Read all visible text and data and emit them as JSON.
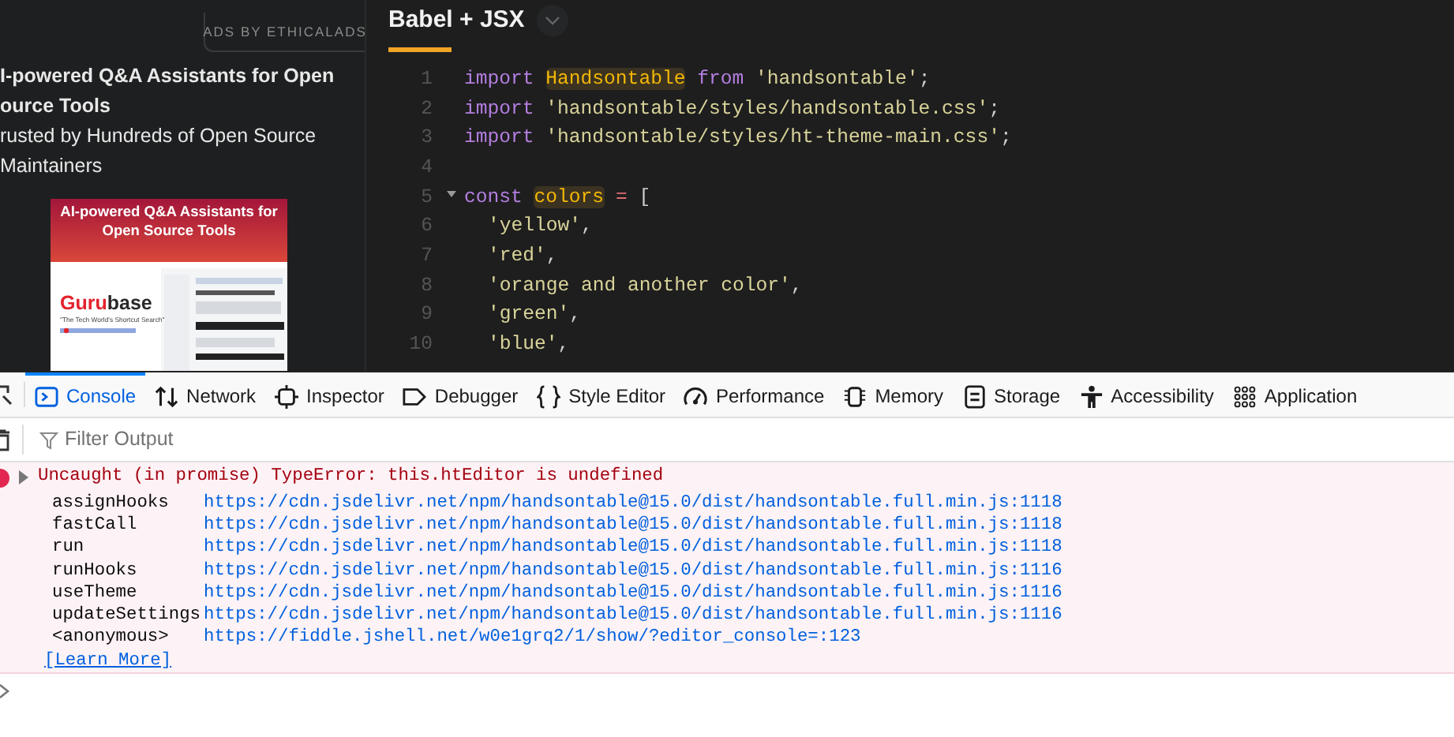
{
  "ad": {
    "label": "ADS BY ETHICALADS",
    "headline": "I-powered Q&A Assistants for Open\nource Tools",
    "body": "rusted by Hundreds of Open Source\nMaintainers",
    "banner": {
      "title": "AI-powered Q&A Assistants for Open Source Tools",
      "logo": [
        {
          "text": "Guru",
          "color": "#e3222c"
        },
        {
          "text": "base",
          "color": "#2a2a2a"
        }
      ],
      "tagline": "\"The Tech World's Shortcut Search\"",
      "kind": "picture"
    }
  },
  "editor": {
    "title": "Babel + JSX",
    "lines": [
      {
        "number": "1",
        "tokens": [
          {
            "kind": "keyword",
            "text": "import "
          },
          {
            "kind": "match",
            "text": "Handsontable"
          },
          {
            "kind": "keyword",
            "text": " from "
          },
          {
            "kind": "string",
            "text": "'handsontable'"
          },
          {
            "kind": "punct",
            "text": ";"
          }
        ]
      },
      {
        "number": "2",
        "tokens": [
          {
            "kind": "keyword",
            "text": "import "
          },
          {
            "kind": "string",
            "text": "'handsontable/styles/handsontable.css'"
          },
          {
            "kind": "punct",
            "text": ";"
          }
        ]
      },
      {
        "number": "3",
        "tokens": [
          {
            "kind": "keyword",
            "text": "import "
          },
          {
            "kind": "string",
            "text": "'handsontable/styles/ht-theme-main.css'"
          },
          {
            "kind": "punct",
            "text": ";"
          }
        ]
      },
      {
        "number": "4"
      },
      {
        "number": "5",
        "tokens": [
          {
            "kind": "keyword",
            "text": "const "
          },
          {
            "kind": "match",
            "text": "colors"
          },
          {
            "kind": "operator",
            "text": " = "
          },
          {
            "kind": "punct",
            "text": "["
          }
        ],
        "children": [
          {
            "number": "6",
            "tokens": [
              {
                "kind": "string",
                "text": "'yellow'"
              },
              {
                "kind": "punct",
                "text": ","
              }
            ]
          },
          {
            "number": "7",
            "tokens": [
              {
                "kind": "string",
                "text": "'red'"
              },
              {
                "kind": "punct",
                "text": ","
              }
            ]
          },
          {
            "number": "8",
            "tokens": [
              {
                "kind": "string",
                "text": "'orange and another color'"
              },
              {
                "kind": "punct",
                "text": ","
              }
            ]
          },
          {
            "number": "9",
            "tokens": [
              {
                "kind": "string",
                "text": "'green'"
              },
              {
                "kind": "punct",
                "text": ","
              }
            ]
          },
          {
            "number": "10",
            "tokens": [
              {
                "kind": "string",
                "text": "'blue'"
              },
              {
                "kind": "punct",
                "text": ","
              }
            ]
          }
        ]
      }
    ]
  },
  "devtools": {
    "tabs": [
      {
        "label": "Console",
        "selected": true
      },
      {
        "label": "Network",
        "selected": false
      },
      {
        "label": "Inspector",
        "selected": false
      },
      {
        "label": "Debugger",
        "selected": false
      },
      {
        "label": "Style Editor",
        "selected": false
      },
      {
        "label": "Performance",
        "selected": false
      },
      {
        "label": "Memory",
        "selected": false
      },
      {
        "label": "Storage",
        "selected": false
      },
      {
        "label": "Accessibility",
        "selected": false
      },
      {
        "label": "Application",
        "selected": false
      }
    ],
    "filter": {
      "placeholder": "Filter Output"
    },
    "error": {
      "message": "Uncaught (in promise) TypeError: this.htEditor is undefined",
      "expanded": false,
      "stack": [
        {
          "function": "assignHooks",
          "location": "https://cdn.jsdelivr.net/npm/handsontable@15.0/dist/handsontable.full.min.js:1118"
        },
        {
          "function": "fastCall",
          "location": "https://cdn.jsdelivr.net/npm/handsontable@15.0/dist/handsontable.full.min.js:1118"
        },
        {
          "function": "run",
          "location": "https://cdn.jsdelivr.net/npm/handsontable@15.0/dist/handsontable.full.min.js:1118"
        },
        {
          "function": "runHooks",
          "location": "https://cdn.jsdelivr.net/npm/handsontable@15.0/dist/handsontable.full.min.js:1116"
        },
        {
          "function": "useTheme",
          "location": "https://cdn.jsdelivr.net/npm/handsontable@15.0/dist/handsontable.full.min.js:1116"
        },
        {
          "function": "updateSettings",
          "location": "https://cdn.jsdelivr.net/npm/handsontable@15.0/dist/handsontable.full.min.js:1116"
        },
        {
          "function": "<anonymous>",
          "location": "https://fiddle.jshell.net/w0e1grq2/1/show/?editor_console=:123"
        }
      ],
      "learn_more": "[Learn More]"
    }
  }
}
